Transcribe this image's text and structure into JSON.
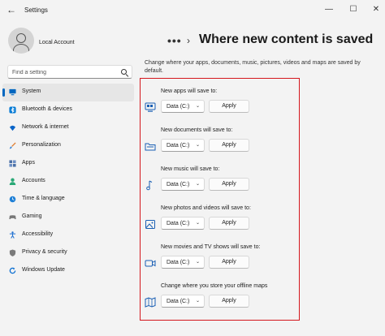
{
  "window": {
    "title": "Settings",
    "back_glyph": "←",
    "minimize_glyph": "—",
    "maximize_glyph": "☐",
    "close_glyph": "✕"
  },
  "account": {
    "name": "Local Account"
  },
  "search": {
    "placeholder": "Find a setting"
  },
  "sidebar": {
    "items": [
      {
        "label": "System",
        "icon": "system-icon",
        "color": "#0067c0",
        "active": true
      },
      {
        "label": "Bluetooth & devices",
        "icon": "bluetooth-icon",
        "color": "#0078d4",
        "active": false
      },
      {
        "label": "Network & internet",
        "icon": "wifi-icon",
        "color": "#0a64c8",
        "active": false
      },
      {
        "label": "Personalization",
        "icon": "brush-icon",
        "color": "#e07a2c",
        "active": false
      },
      {
        "label": "Apps",
        "icon": "apps-icon",
        "color": "#4a6fa5",
        "active": false
      },
      {
        "label": "Accounts",
        "icon": "person-icon",
        "color": "#2aa876",
        "active": false
      },
      {
        "label": "Time & language",
        "icon": "globe-clock-icon",
        "color": "#1e7fd6",
        "active": false
      },
      {
        "label": "Gaming",
        "icon": "gamepad-icon",
        "color": "#777777",
        "active": false
      },
      {
        "label": "Accessibility",
        "icon": "accessibility-icon",
        "color": "#1d6fd1",
        "active": false
      },
      {
        "label": "Privacy & security",
        "icon": "shield-icon",
        "color": "#7a7a7a",
        "active": false
      },
      {
        "label": "Windows Update",
        "icon": "update-icon",
        "color": "#0a6ed1",
        "active": false
      }
    ]
  },
  "breadcrumb": {
    "dots": "•••",
    "separator": "›",
    "title": "Where new content is saved"
  },
  "description": "Change where your apps, documents, music, pictures, videos and maps are saved by default.",
  "groups": [
    {
      "label": "New apps will save to:",
      "icon": "apps-storage-icon",
      "drive": "Data (C:)",
      "apply": "Apply"
    },
    {
      "label": "New documents will save to:",
      "icon": "folder-icon",
      "drive": "Data (C:)",
      "apply": "Apply"
    },
    {
      "label": "New music will save to:",
      "icon": "music-note-icon",
      "drive": "Data (C:)",
      "apply": "Apply"
    },
    {
      "label": "New photos and videos will save to:",
      "icon": "picture-icon",
      "drive": "Data (C:)",
      "apply": "Apply"
    },
    {
      "label": "New movies and TV shows will save to:",
      "icon": "video-camera-icon",
      "drive": "Data (C:)",
      "apply": "Apply"
    },
    {
      "label": "Change where you store your offline maps",
      "icon": "map-icon",
      "drive": "Data (C:)",
      "apply": "Apply"
    }
  ],
  "chevron_glyph": "⌄",
  "highlight_color": "#d4161c"
}
